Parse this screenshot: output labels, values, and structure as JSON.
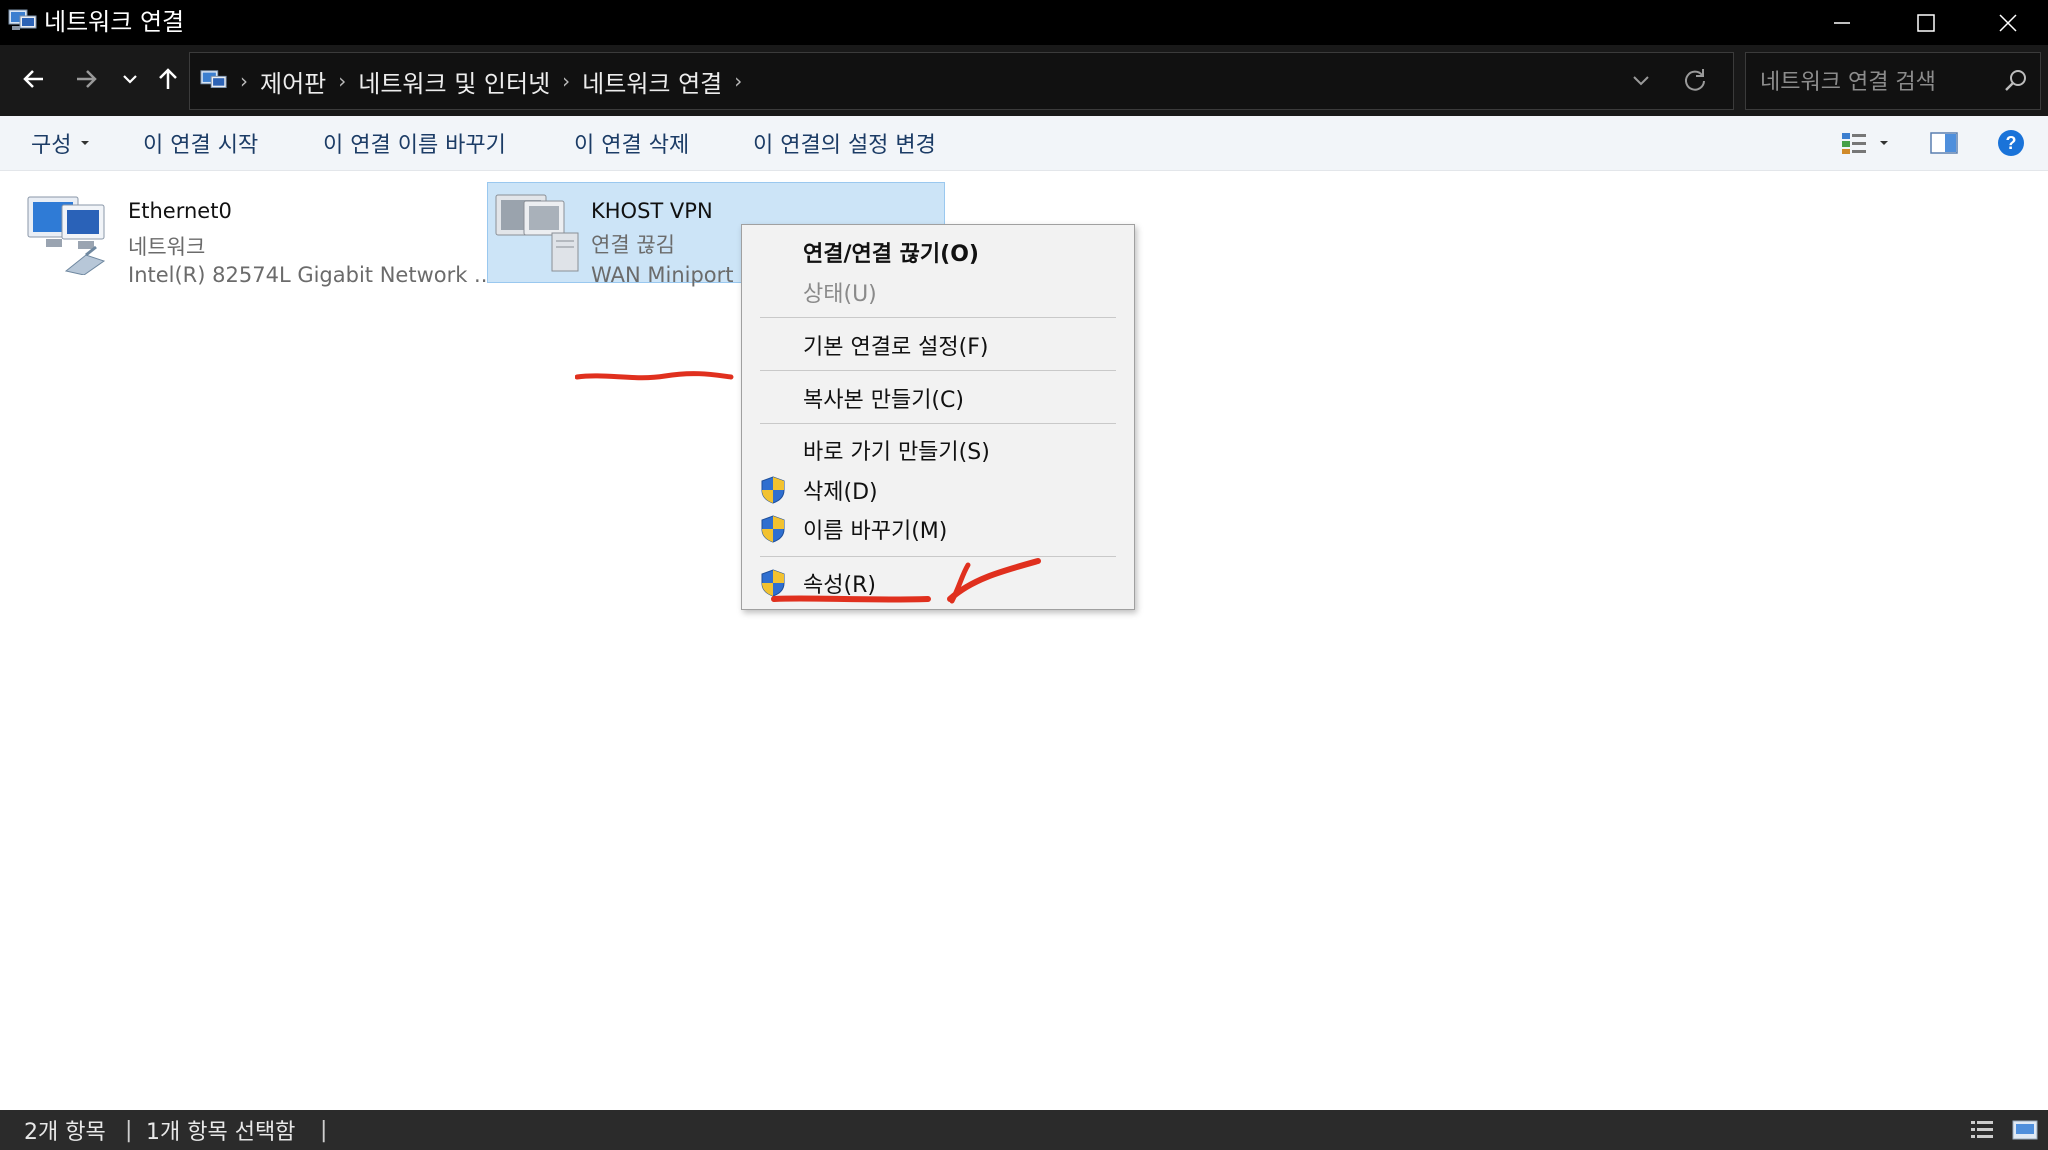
{
  "window": {
    "title": "네트워크 연결",
    "minimize": "minimize",
    "maximize": "maximize",
    "close": "close"
  },
  "nav": {
    "breadcrumbs": [
      "제어판",
      "네트워크 및 인터넷",
      "네트워크 연결"
    ],
    "search_placeholder": "네트워크 연결 검색"
  },
  "commands": {
    "organize": "구성",
    "start": "이 연결 시작",
    "rename": "이 연결 이름 바꾸기",
    "delete": "이 연결 삭제",
    "change_settings": "이 연결의 설정 변경"
  },
  "items": [
    {
      "name": "Ethernet0",
      "status": "네트워크",
      "device": "Intel(R) 82574L Gigabit Network ..."
    },
    {
      "name": "KHOST VPN",
      "status": "연결 끊김",
      "device": "WAN Miniport"
    }
  ],
  "context_menu": {
    "connect": "연결/연결 끊기(O)",
    "status": "상태(U)",
    "set_default": "기본 연결로 설정(F)",
    "copy": "복사본 만들기(C)",
    "shortcut": "바로 가기 만들기(S)",
    "delete": "삭제(D)",
    "rename": "이름 바꾸기(M)",
    "properties": "속성(R)"
  },
  "status_bar": {
    "count": "2개 항목",
    "selected": "1개 항목 선택함"
  },
  "colors": {
    "accent_link": "#1c3c66",
    "selection": "#cce4f7",
    "annotation": "#e0301e"
  }
}
